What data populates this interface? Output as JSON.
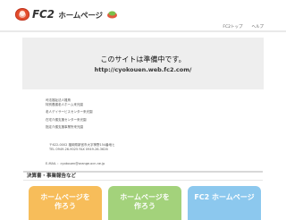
{
  "header": {
    "logo_fc2": "FC2",
    "logo_sub": "ホームページ",
    "nav": [
      "FC2トップ",
      "ヘルプ"
    ]
  },
  "prep": {
    "title": "このサイトは準備中です。",
    "url": "http://cyokouen.web.fc2.com/"
  },
  "info": {
    "lines": [
      "司法福祉法人雛鳥",
      "特別養護老人ホーム来光園",
      "",
      "老人デイサービスセンター来光園",
      "",
      "在宅介護支援センター来光園",
      "",
      "指定介護支援事業所来光園"
    ],
    "contact": [
      "〒622-0002 福岡県新宮市大字神野154番地ヒ",
      "TEL 0949-26-9025 FAX 0949-26-3626"
    ],
    "email": "E-MAIL  ：cyokouen@orange.ocn.ne.jp"
  },
  "section": {
    "title": "決算書・事業報告など"
  },
  "ads": [
    {
      "line1": "ホームページを",
      "line2": "作ろう"
    },
    {
      "line1": "ホームページを",
      "line2": "作ろう"
    },
    {
      "line1": "FC2 ホームページ",
      "line2": ""
    }
  ],
  "colors": {
    "ad1": "#f7bd5a",
    "ad2": "#a3d27b",
    "ad3": "#8cc8ee"
  }
}
